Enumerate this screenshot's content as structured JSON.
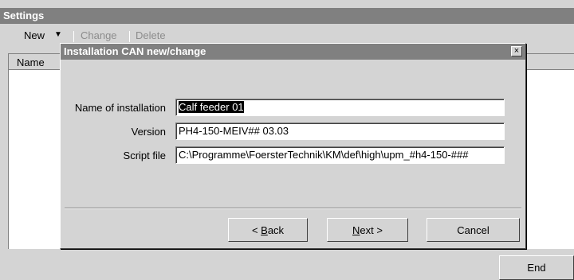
{
  "settings": {
    "title": "Settings",
    "toolbar": {
      "new_label": "New",
      "arrow": "▼",
      "change_label": "Change",
      "delete_label": "Delete"
    },
    "list": {
      "columns": [
        "Name"
      ]
    },
    "end_label": "End"
  },
  "dialog": {
    "title": "Installation CAN new/change",
    "close_glyph": "×",
    "fields": [
      {
        "label": "Name of installation",
        "value": "Calf feeder 01"
      },
      {
        "label": "Version",
        "value": "PH4-150-MEIV## 03.03"
      },
      {
        "label": "Script file",
        "value": "C:\\Programme\\FoersterTechnik\\KM\\def\\high\\upm_#h4-150-###"
      }
    ],
    "buttons": {
      "back_prefix": "< ",
      "back_accel": "B",
      "back_rest": "ack",
      "next_accel": "N",
      "next_rest": "ext >",
      "cancel": "Cancel"
    }
  }
}
